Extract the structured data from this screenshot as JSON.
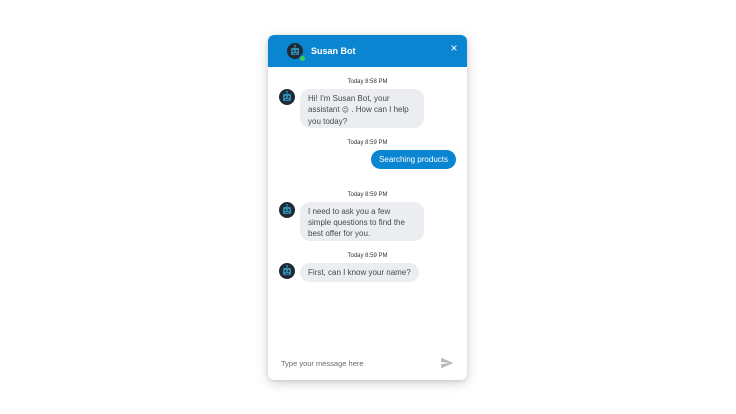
{
  "header": {
    "title": "Susan Bot",
    "close_label": "×",
    "avatar_icon": "robot-icon",
    "status": "online",
    "color": "#0a85d1"
  },
  "messages": [
    {
      "sender": "bot",
      "timestamp": "Today 8:58 PM",
      "line1": "Hi! I'm Susan Bot, your",
      "line2_pre": "assistant ",
      "emoji": "😉",
      "line2_post": " . How can I help",
      "line3": "you today?"
    },
    {
      "sender": "user",
      "timestamp": "Today 8:59 PM",
      "text": "Searching products"
    },
    {
      "sender": "bot",
      "timestamp": "Today 8:59 PM",
      "line1": "I need to ask you a few",
      "line2": "simple questions to find the",
      "line3": "best offer for you."
    },
    {
      "sender": "bot",
      "timestamp": "Today 8:59 PM",
      "text": "First, can I know your name?"
    }
  ],
  "composer": {
    "placeholder": "Type your message here",
    "send_icon": "send-icon"
  },
  "colors": {
    "accent": "#0a85d1",
    "bot_bubble": "#ebedf0",
    "online": "#3ccf4e"
  }
}
